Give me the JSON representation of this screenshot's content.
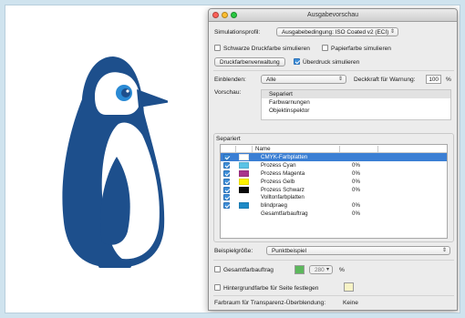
{
  "dialog": {
    "title": "Ausgabevorschau",
    "simulation": {
      "label": "Simulationsprofil:",
      "value": "Ausgabebedingung: ISO Coated v2 (ECI)"
    },
    "options": {
      "black_ink": {
        "label": "Schwarze Druckfarbe simulieren",
        "checked": false
      },
      "paper_color": {
        "label": "Papierfarbe simulieren",
        "checked": false
      },
      "ink_manager": "Druckfarbenverwaltung",
      "overprint": {
        "label": "Überdruck simulieren",
        "checked": true
      }
    },
    "show": {
      "label": "Einblenden:",
      "value": "Alle"
    },
    "opacity": {
      "label": "Deckkraft für Warnung:",
      "value": "100",
      "unit": "%"
    },
    "preview": {
      "label": "Vorschau:",
      "items": [
        "Separiert",
        "Farbwarnungen",
        "Objektinspektor"
      ],
      "selected_index": 0
    },
    "separations": {
      "group_label": "Separiert",
      "column_name": "Name",
      "rows": [
        {
          "name": "CMYK-Farbplatten",
          "checked": true,
          "color": "#ffffff",
          "percent": "",
          "selected": true
        },
        {
          "name": "Prozess Cyan",
          "checked": true,
          "color": "#5bc3e6",
          "percent": "0%",
          "selected": false
        },
        {
          "name": "Prozess Magenta",
          "checked": true,
          "color": "#a8348c",
          "percent": "0%",
          "selected": false
        },
        {
          "name": "Prozess Gelb",
          "checked": true,
          "color": "#fff200",
          "percent": "0%",
          "selected": false
        },
        {
          "name": "Prozess Schwarz",
          "checked": true,
          "color": "#0a0a0a",
          "percent": "0%",
          "selected": false
        },
        {
          "name": "Volltonfarbplatten",
          "checked": true,
          "color": "",
          "percent": "",
          "selected": false
        },
        {
          "name": "blindpraeg",
          "checked": true,
          "color": "#1e8ac6",
          "percent": "0%",
          "selected": false
        },
        {
          "name": "Gesamtfarbauftrag",
          "checked": false,
          "color": "",
          "percent": "0%",
          "selected": false
        }
      ]
    },
    "sample_size": {
      "label": "Beispielgröße:",
      "value": "Punktbeispiel"
    },
    "total_ink": {
      "label": "Gesamtfarbauftrag",
      "checked": false,
      "color": "#5cb85c",
      "value": "280",
      "unit": "%"
    },
    "background": {
      "label": "Hintergrundfarbe für Seite festlegen",
      "checked": false,
      "color": "#f7f3c6"
    },
    "transparency": {
      "label": "Farbraum für Transparenz-Überblendung:",
      "value": "Keine"
    }
  },
  "colors": {
    "penguin": "#1d4f8c",
    "eye": "#2a8ad4",
    "background": "#cfe3ee"
  }
}
